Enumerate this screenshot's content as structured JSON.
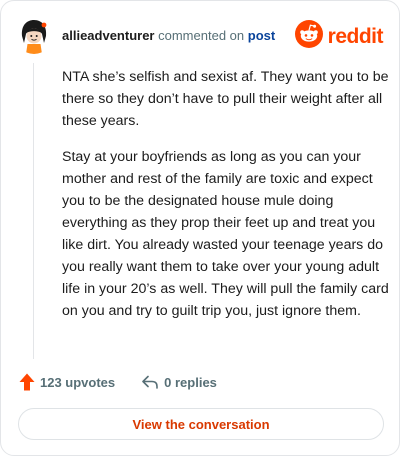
{
  "header": {
    "username": "allieadventurer",
    "commented_on": "commented on",
    "post_link": "post",
    "brand_word": "reddit"
  },
  "comment": {
    "paragraphs": [
      "NTA she’s selfish and sexist af. They want you to be there so they don’t have to pull their weight after all these years.",
      "Stay at your boyfriends as long as you can your mother and rest of the family are toxic and expect you to be the designated house mule doing everything as they prop their feet up and treat you like dirt. You already wasted your teenage years do you really want them to take over your young adult life in your 20’s as well. They will pull the family card on you and try to guilt trip you, just ignore them."
    ]
  },
  "actions": {
    "upvotes": "123 upvotes",
    "replies": "0 replies"
  },
  "cta": {
    "label": "View the conversation"
  },
  "colors": {
    "brand": "#ff4500",
    "link": "#0a449b",
    "cta_text": "#d93900"
  },
  "icons": [
    "avatar",
    "reddit-logo-icon",
    "upvote-arrow-icon",
    "reply-icon"
  ]
}
